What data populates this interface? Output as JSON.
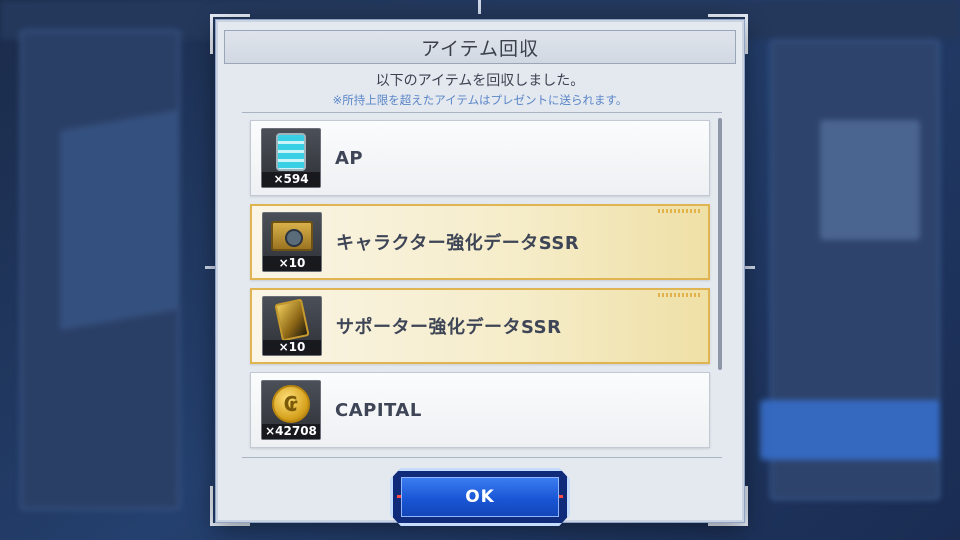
{
  "dialog": {
    "title": "アイテム回収",
    "message": "以下のアイテムを回収しました。",
    "note": "※所持上限を超えたアイテムはプレゼントに送られます。"
  },
  "items": [
    {
      "name": "AP",
      "quantity": "×594",
      "rarity": "normal",
      "icon": "ap-canister-icon"
    },
    {
      "name": "キャラクター強化データSSR",
      "quantity": "×10",
      "rarity": "ssr",
      "icon": "character-data-case-icon"
    },
    {
      "name": "サポーター強化データSSR",
      "quantity": "×10",
      "rarity": "ssr",
      "icon": "supporter-data-card-icon"
    },
    {
      "name": "CAPITAL",
      "quantity": "×42708",
      "rarity": "normal",
      "icon": "capital-coin-icon"
    }
  ],
  "ok_button": {
    "label": "OK"
  },
  "colors": {
    "ssr_border": "#e0b450",
    "ok_blue": "#1a56d6",
    "note_blue": "#5a86c8"
  }
}
